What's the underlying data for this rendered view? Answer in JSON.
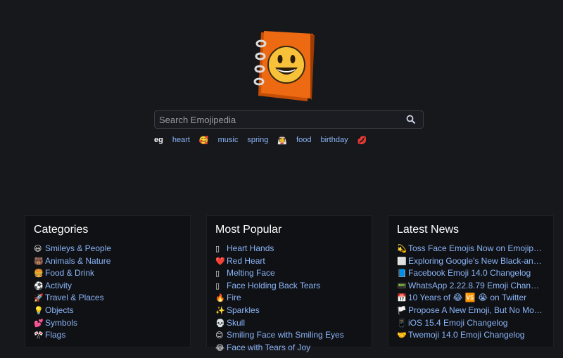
{
  "search": {
    "placeholder": "Search Emojipedia"
  },
  "suggestions": {
    "eg_label": "eg",
    "items": [
      {
        "text": "heart",
        "kind": "text"
      },
      {
        "text": "🥰",
        "kind": "emoji"
      },
      {
        "text": "music",
        "kind": "text"
      },
      {
        "text": "spring",
        "kind": "text"
      },
      {
        "text": "👰",
        "kind": "emoji"
      },
      {
        "text": "food",
        "kind": "text"
      },
      {
        "text": "birthday",
        "kind": "text"
      },
      {
        "text": "💋",
        "kind": "emoji"
      }
    ]
  },
  "categories": {
    "title": "Categories",
    "items": [
      {
        "emoji": "😃",
        "label": "Smileys & People"
      },
      {
        "emoji": "🐻",
        "label": "Animals & Nature"
      },
      {
        "emoji": "🍔",
        "label": "Food & Drink"
      },
      {
        "emoji": "⚽",
        "label": "Activity"
      },
      {
        "emoji": "🚀",
        "label": "Travel & Places"
      },
      {
        "emoji": "💡",
        "label": "Objects"
      },
      {
        "emoji": "💕",
        "label": "Symbols"
      },
      {
        "emoji": "🎌",
        "label": "Flags"
      }
    ]
  },
  "popular": {
    "title": "Most Popular",
    "items": [
      {
        "emoji": "▯",
        "label": "Heart Hands"
      },
      {
        "emoji": "❤️",
        "label": "Red Heart"
      },
      {
        "emoji": "▯",
        "label": "Melting Face"
      },
      {
        "emoji": "▯",
        "label": "Face Holding Back Tears"
      },
      {
        "emoji": "🔥",
        "label": "Fire"
      },
      {
        "emoji": "✨",
        "label": "Sparkles"
      },
      {
        "emoji": "💀",
        "label": "Skull"
      },
      {
        "emoji": "😊",
        "label": "Smiling Face with Smiling Eyes"
      },
      {
        "emoji": "😂",
        "label": "Face with Tears of Joy"
      }
    ]
  },
  "news": {
    "title": "Latest News",
    "items": [
      {
        "emoji": "💫",
        "label": "Toss Face Emojis Now on Emojip…"
      },
      {
        "emoji": "⬜",
        "label": "Exploring Google's New Black-an…"
      },
      {
        "emoji": "📘",
        "label": "Facebook Emoji 14.0 Changelog"
      },
      {
        "emoji": "📟",
        "label": "WhatsApp 2.22.8.79 Emoji Chan…"
      },
      {
        "emoji": "📅",
        "label": "10 Years of 😂 🆚 😭 on Twitter"
      },
      {
        "emoji": "🏳️",
        "label": "Propose A New Emoji, But No Mo…"
      },
      {
        "emoji": "📱",
        "label": "iOS 15.4 Emoji Changelog"
      },
      {
        "emoji": "🤝",
        "label": "Twemoji 14.0 Emoji Changelog"
      }
    ]
  },
  "colors": {
    "accent_link": "#8ab4f8",
    "background": "#17181c",
    "panel": "#101114",
    "logo_orange": "#e8620e"
  }
}
